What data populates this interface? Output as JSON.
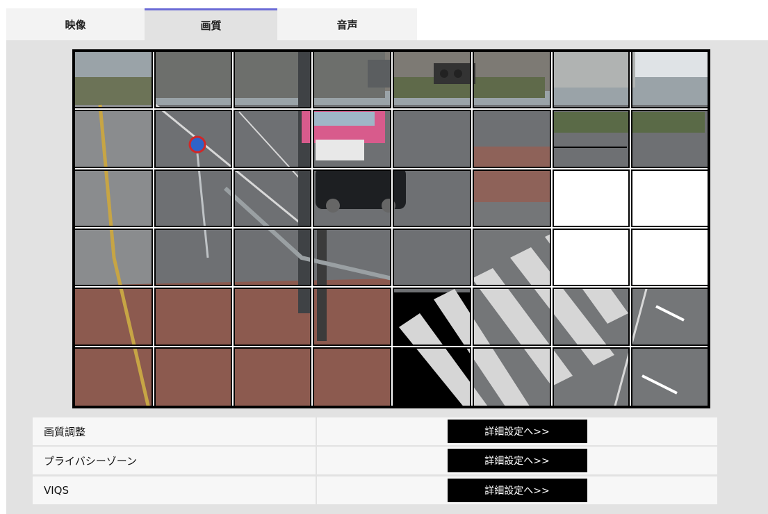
{
  "tabs": [
    {
      "label": "映像",
      "active": false
    },
    {
      "label": "画質",
      "active": true
    },
    {
      "label": "音声",
      "active": false
    }
  ],
  "video": {
    "grid_columns": 8,
    "grid_rows": 6,
    "masked_cells": [
      [
        2,
        6
      ],
      [
        2,
        7
      ],
      [
        3,
        6
      ],
      [
        3,
        7
      ]
    ]
  },
  "settings": [
    {
      "label": "画質調整",
      "button": "詳細設定へ>>"
    },
    {
      "label": "プライバシーゾーン",
      "button": "詳細設定へ>>"
    },
    {
      "label": "VIQS",
      "button": "詳細設定へ>>"
    }
  ],
  "colors": {
    "accent": "#6b6bd6",
    "panel": "#e2e2e2",
    "button": "#000000"
  }
}
